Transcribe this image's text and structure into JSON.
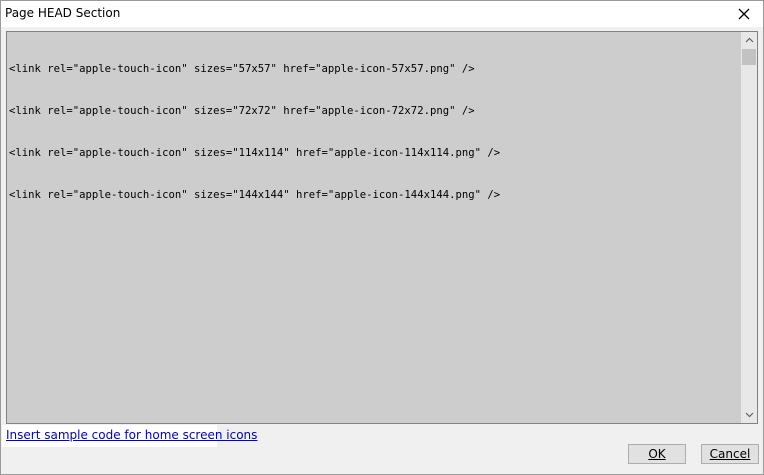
{
  "window": {
    "title": "Page HEAD Section"
  },
  "editor": {
    "lines": [
      "<link rel=\"apple-touch-icon\" sizes=\"57x57\" href=\"apple-icon-57x57.png\" />",
      "<link rel=\"apple-touch-icon\" sizes=\"72x72\" href=\"apple-icon-72x72.png\" />",
      "<link rel=\"apple-touch-icon\" sizes=\"114x114\" href=\"apple-icon-114x114.png\" />",
      "<link rel=\"apple-touch-icon\" sizes=\"144x144\" href=\"apple-icon-144x144.png\" />"
    ]
  },
  "footer": {
    "sample_link": "Insert sample code for home screen icons",
    "ok_label": "OK",
    "cancel_label": "Cancel"
  },
  "icons": {
    "close": "close-icon",
    "scroll_up": "chevron-up-icon",
    "scroll_down": "chevron-down-icon"
  }
}
